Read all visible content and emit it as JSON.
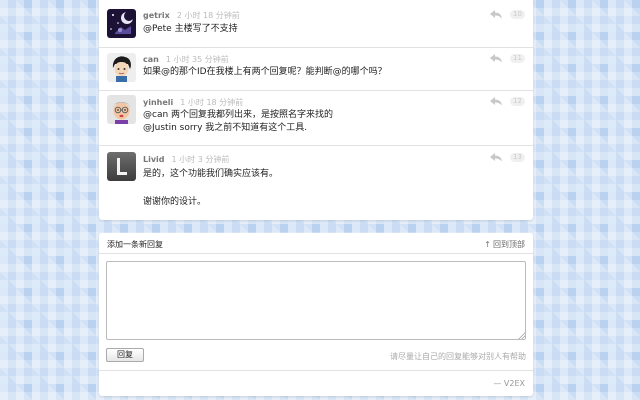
{
  "replies": [
    {
      "username": "getrix",
      "time": "2 小时 18 分钟前",
      "floor": "10",
      "lines": [
        "@Pete 主楼写了不支持"
      ]
    },
    {
      "username": "can",
      "time": "1 小时 35 分钟前",
      "floor": "11",
      "lines": [
        "如果@的那个ID在我楼上有两个回复呢？能判断@的哪个吗？"
      ]
    },
    {
      "username": "yinheli",
      "time": "1 小时 18 分钟前",
      "floor": "12",
      "lines": [
        "@can 两个回复我都列出来，是按照名字来找的",
        "@Justin sorry 我之前不知道有这个工具."
      ]
    },
    {
      "username": "Livid",
      "time": "1 小时 3 分钟前",
      "floor": "13",
      "lines": [
        "是的，这个功能我们确实应该有。",
        "",
        "谢谢你的设计。"
      ]
    }
  ],
  "new_reply": {
    "title": "添加一条新回复",
    "back_to_top_arrow": "↑",
    "back_to_top": "回到顶部",
    "textarea_value": "",
    "submit_label": "回复",
    "hint": "请尽量让自己的回复能够对别人有帮助",
    "brand": "— V2EX"
  },
  "icons": {
    "reply": "reply-arrow-icon"
  }
}
